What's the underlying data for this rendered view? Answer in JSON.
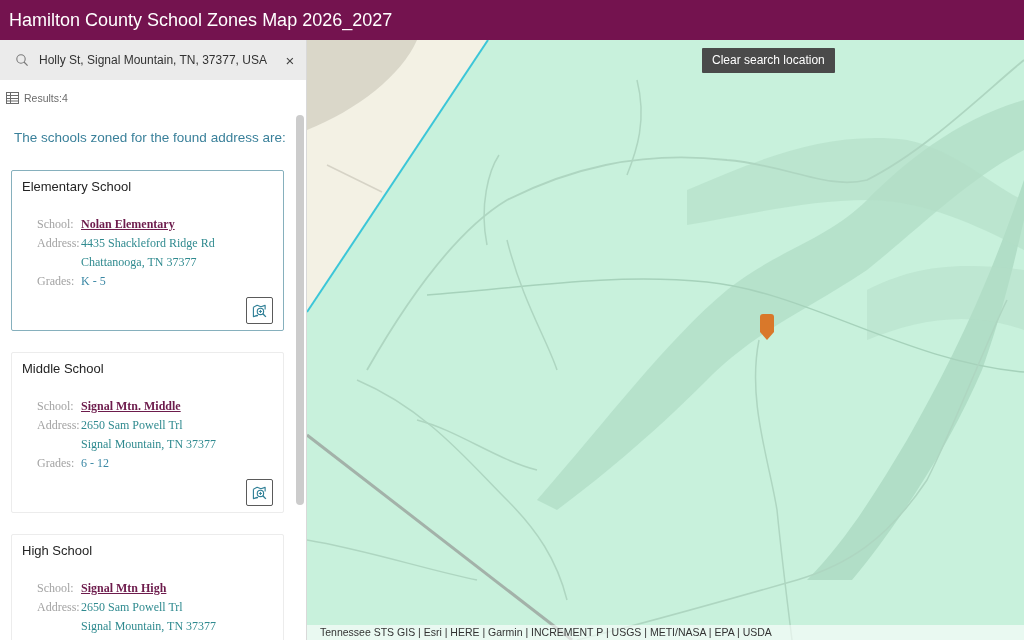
{
  "header": {
    "title": "Hamilton County School Zones Map 2026_2027"
  },
  "search": {
    "value": "Holly St, Signal Mountain, TN, 37377, USA",
    "clear_label": "×"
  },
  "results": {
    "label": "Results:4"
  },
  "panel": {
    "heading": "The schools zoned for the found address are:",
    "cards": [
      {
        "title": "Elementary School",
        "selected": true,
        "zoom_button": true,
        "rows": [
          {
            "kind": "link",
            "label": "School:",
            "value": "Nolan Elementary"
          },
          {
            "kind": "address",
            "label": "Address:",
            "lines": [
              "4435 Shackleford Ridge Rd",
              "Chattanooga, TN 37377"
            ]
          },
          {
            "kind": "text",
            "label": "Grades:",
            "value": "K - 5"
          }
        ]
      },
      {
        "title": "Middle School",
        "selected": false,
        "zoom_button": true,
        "rows": [
          {
            "kind": "link",
            "label": "School:",
            "value": "Signal Mtn. Middle"
          },
          {
            "kind": "address",
            "label": "Address:",
            "lines": [
              "2650 Sam Powell Trl",
              "Signal Mountain, TN 37377"
            ]
          },
          {
            "kind": "text",
            "label": "Grades:",
            "value": "6 - 12"
          }
        ]
      },
      {
        "title": "High School",
        "selected": false,
        "rows": [
          {
            "kind": "link",
            "label": "School:",
            "value": "Signal Mtn High"
          },
          {
            "kind": "address",
            "label": "Address:",
            "lines": [
              "2650 Sam Powell Trl",
              "Signal Mountain, TN 37377"
            ]
          }
        ]
      }
    ]
  },
  "map": {
    "clear_search_button": "Clear search location",
    "attribution": "Tennessee STS GIS | Esri | HERE | Garmin | INCREMENT P | USGS | METI/NASA | EPA | USDA"
  }
}
